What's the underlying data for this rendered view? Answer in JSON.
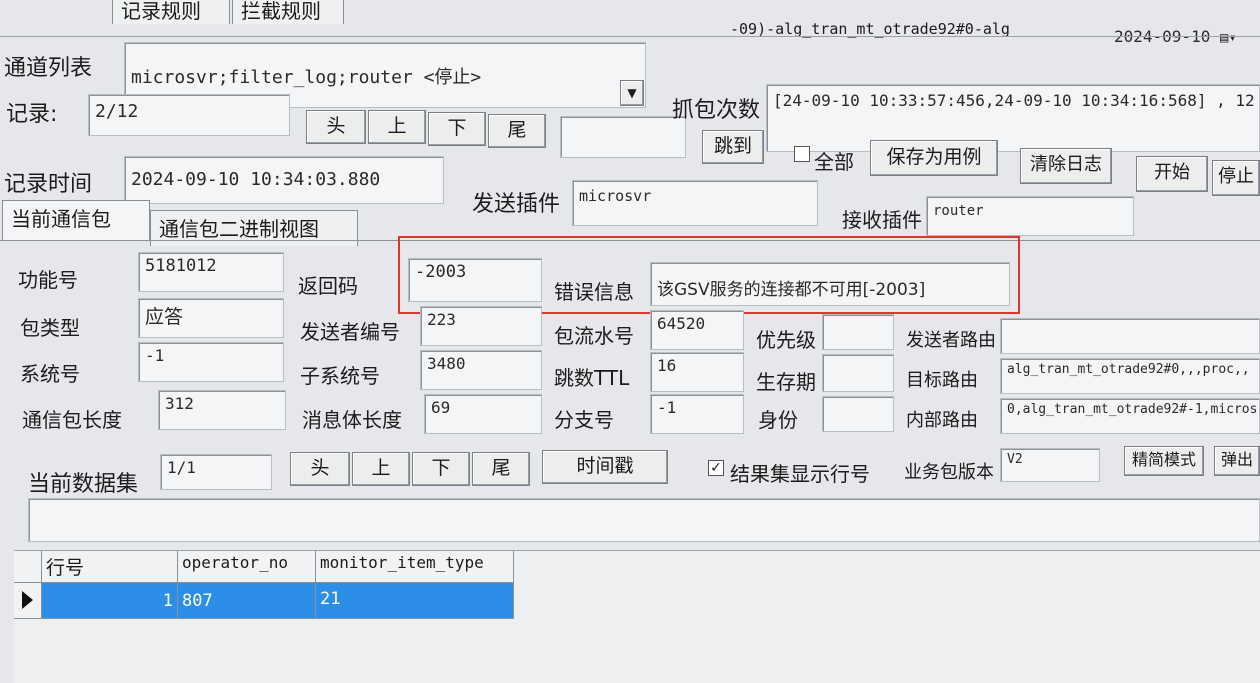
{
  "top": {
    "tabs": [
      "记录规则",
      "拦截规则"
    ],
    "title_fragment": "-09)-alg_tran_mt_otrade92#0-alg",
    "date": "2024-09-10"
  },
  "channel": {
    "label": "通道列表",
    "value": "microsvr;filter_log;router <停止>"
  },
  "record": {
    "label": "记录:",
    "value": "2/12",
    "nav": [
      "头",
      "上",
      "下",
      "尾"
    ],
    "capture_label": "抓包次数",
    "capture_value": "[24-09-10 10:33:57:456,24-09-10 10:34:16:568] , 12",
    "jump_input": "",
    "jump_label": "跳到",
    "all_label": "全部",
    "save_label": "保存为用例",
    "clear_label": "清除日志",
    "start_label": "开始",
    "stop_label": "停止"
  },
  "record_time": {
    "label": "记录时间",
    "value": "2024-09-10 10:34:03.880"
  },
  "send_plugin": {
    "label": "发送插件",
    "value": "microsvr"
  },
  "recv_plugin": {
    "label": "接收插件",
    "value": "router"
  },
  "packet_tabs": [
    "当前通信包",
    "通信包二进制视图"
  ],
  "fields": {
    "func_no": {
      "label": "功能号",
      "value": "5181012"
    },
    "return_code": {
      "label": "返回码",
      "value": "-2003"
    },
    "error_info": {
      "label": "错误信息",
      "value": "该GSV服务的连接都不可用[-2003]"
    },
    "pkt_type": {
      "label": "包类型",
      "value": "应答"
    },
    "sender_no": {
      "label": "发送者编号",
      "value": "223"
    },
    "pkt_serial": {
      "label": "包流水号",
      "value": "64520"
    },
    "priority": {
      "label": "优先级",
      "value": ""
    },
    "sender_route": {
      "label": "发送者路由",
      "value": ""
    },
    "system_no": {
      "label": "系统号",
      "value": "-1"
    },
    "subsystem_no": {
      "label": "子系统号",
      "value": "3480"
    },
    "hops": {
      "label": "跳数TTL",
      "value": "16"
    },
    "lifetime": {
      "label": "生存期",
      "value": ""
    },
    "target_route": {
      "label": "目标路由",
      "value": "alg_tran_mt_otrade92#0,,,proc,,"
    },
    "pkt_length": {
      "label": "通信包长度",
      "value": "312"
    },
    "msg_length": {
      "label": "消息体长度",
      "value": "69"
    },
    "branch_no": {
      "label": "分支号",
      "value": "-1"
    },
    "identity": {
      "label": "身份",
      "value": ""
    },
    "internal_route": {
      "label": "内部路由",
      "value": "0,alg_tran_mt_otrade92#-1,micros"
    }
  },
  "dataset": {
    "label": "当前数据集",
    "value": "1/1",
    "nav": [
      "头",
      "上",
      "下",
      "尾"
    ],
    "timestamp_label": "时间戳",
    "show_rownum_label": "结果集显示行号",
    "version_label": "业务包版本",
    "version_value": "V2",
    "compact_label": "精简模式",
    "popup_label": "弹出"
  },
  "table": {
    "headers": [
      "行号",
      "operator_no",
      "monitor_item_type"
    ],
    "rows": [
      [
        "1",
        "807",
        "21"
      ]
    ]
  }
}
